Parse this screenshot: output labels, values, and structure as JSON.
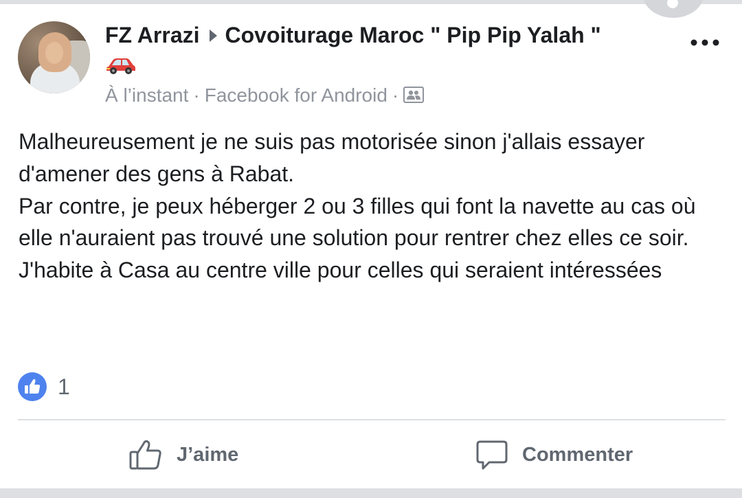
{
  "post": {
    "author": "FZ Arrazi",
    "group": "Covoiturage Maroc \" Pip Pip Yalah \"",
    "group_emoji_icon": "red-car-icon",
    "timestamp": "À l’instant",
    "source": "Facebook for Android",
    "privacy_icon": "group-privacy-icon",
    "body": [
      "Malheureusement je ne suis pas motorisée sinon j'allais essayer d'amener des gens à Rabat.",
      "Par contre, je peux héberger 2 ou 3 filles qui font la navette au cas où elle n'auraient pas trouvé une solution pour rentrer chez elles ce soir.",
      "J'habite à Casa au centre ville pour celles qui seraient intéressées"
    ]
  },
  "reactions": {
    "icon": "like-icon",
    "count": "1"
  },
  "actions": {
    "like_label": "J’aime",
    "comment_label": "Commenter"
  },
  "colors": {
    "like_blue": "#4e82ee",
    "car_red": "#e0403b",
    "secondary_text": "#90949c",
    "action_gray": "#606770"
  }
}
